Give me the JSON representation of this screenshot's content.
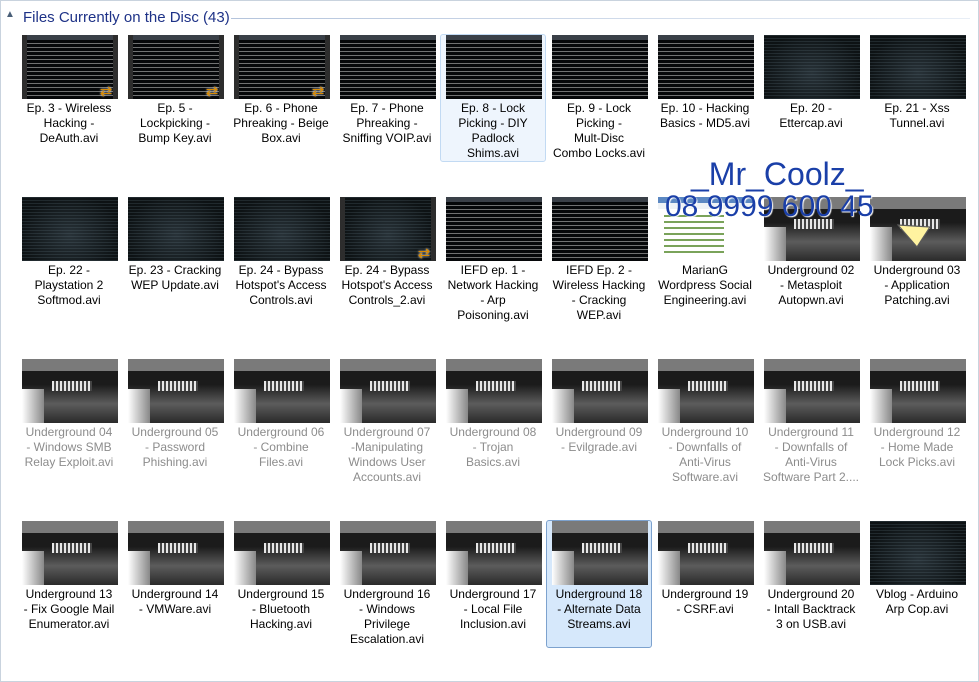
{
  "group": {
    "title": "Files Currently on the Disc (43)",
    "collapse_icon": "chevron-up-icon"
  },
  "watermark": {
    "name": "_Mr_Coolz_",
    "phone": "08 9999 600 45"
  },
  "files": [
    {
      "name": "Ep. 3 - Wireless\nHacking -\nDeAuth.avi",
      "thumb": "term",
      "film": true,
      "badge": true,
      "faded": false,
      "state": ""
    },
    {
      "name": "Ep. 5 -\nLockpicking -\nBump Key.avi",
      "thumb": "term",
      "film": true,
      "badge": true,
      "faded": false,
      "state": ""
    },
    {
      "name": "Ep. 6 - Phone\nPhreaking - Beige\nBox.avi",
      "thumb": "term",
      "film": true,
      "badge": true,
      "faded": false,
      "state": ""
    },
    {
      "name": "Ep. 7 - Phone\nPhreaking -\nSniffing VOIP.avi",
      "thumb": "term",
      "film": false,
      "badge": false,
      "faded": false,
      "state": ""
    },
    {
      "name": "Ep. 8 - Lock\nPicking - DIY\nPadlock\nShims.avi",
      "thumb": "term",
      "film": false,
      "badge": false,
      "faded": false,
      "state": "hover"
    },
    {
      "name": "Ep. 9 - Lock\nPicking -\nMult-Disc\nCombo Locks.avi",
      "thumb": "term",
      "film": false,
      "badge": false,
      "faded": false,
      "state": ""
    },
    {
      "name": "Ep. 10 - Hacking\nBasics - MD5.avi",
      "thumb": "term",
      "film": false,
      "badge": false,
      "faded": false,
      "state": ""
    },
    {
      "name": "Ep. 20 -\nEttercap.avi",
      "thumb": "dark",
      "film": false,
      "badge": false,
      "faded": false,
      "state": ""
    },
    {
      "name": "Ep. 21 - Xss\nTunnel.avi",
      "thumb": "dark",
      "film": false,
      "badge": false,
      "faded": false,
      "state": ""
    },
    {
      "name": "Ep. 22 -\nPlaystation 2\nSoftmod.avi",
      "thumb": "dark",
      "film": false,
      "badge": false,
      "faded": false,
      "state": ""
    },
    {
      "name": "Ep. 23 - Cracking\nWEP Update.avi",
      "thumb": "dark",
      "film": false,
      "badge": false,
      "faded": false,
      "state": ""
    },
    {
      "name": "Ep. 24 - Bypass\nHotspot's Access\nControls.avi",
      "thumb": "dark",
      "film": false,
      "badge": false,
      "faded": false,
      "state": ""
    },
    {
      "name": "Ep. 24 - Bypass\nHotspot's Access\nControls_2.avi",
      "thumb": "dark",
      "film": true,
      "badge": true,
      "faded": false,
      "state": ""
    },
    {
      "name": "IEFD ep. 1 -\nNetwork Hacking\n- Arp\nPoisoning.avi",
      "thumb": "term",
      "film": false,
      "badge": false,
      "faded": false,
      "state": ""
    },
    {
      "name": "IEFD Ep. 2 -\nWireless Hacking\n- Cracking\nWEP.avi",
      "thumb": "term",
      "film": false,
      "badge": false,
      "faded": false,
      "state": ""
    },
    {
      "name": "MarianG\nWordpress Social\nEngineering.avi",
      "thumb": "browser",
      "film": false,
      "badge": false,
      "faded": false,
      "state": ""
    },
    {
      "name": "Underground 02\n- Metasploit\nAutopwn.avi",
      "thumb": "ug",
      "film": false,
      "badge": false,
      "faded": false,
      "state": ""
    },
    {
      "name": "Underground 03\n- Application\nPatching.avi",
      "thumb": "ug",
      "film": false,
      "badge": false,
      "faded": false,
      "state": ""
    },
    {
      "name": "Underground 04\n- Windows SMB\nRelay Exploit.avi",
      "thumb": "ug",
      "film": false,
      "badge": false,
      "faded": true,
      "state": ""
    },
    {
      "name": "Underground 05\n- Password\nPhishing.avi",
      "thumb": "ug",
      "film": false,
      "badge": false,
      "faded": true,
      "state": ""
    },
    {
      "name": "Underground 06\n- Combine\nFiles.avi",
      "thumb": "ug",
      "film": false,
      "badge": false,
      "faded": true,
      "state": ""
    },
    {
      "name": "Underground 07\n-Manipulating\nWindows User\nAccounts.avi",
      "thumb": "ug",
      "film": false,
      "badge": false,
      "faded": true,
      "state": ""
    },
    {
      "name": "Underground 08\n- Trojan\nBasics.avi",
      "thumb": "ug",
      "film": false,
      "badge": false,
      "faded": true,
      "state": ""
    },
    {
      "name": "Underground 09\n- Evilgrade.avi",
      "thumb": "ug",
      "film": false,
      "badge": false,
      "faded": true,
      "state": ""
    },
    {
      "name": "Underground 10\n- Downfalls of\nAnti-Virus\nSoftware.avi",
      "thumb": "ug",
      "film": false,
      "badge": false,
      "faded": true,
      "state": ""
    },
    {
      "name": "Underground 11\n- Downfalls of\nAnti-Virus\nSoftware Part 2....",
      "thumb": "ug",
      "film": false,
      "badge": false,
      "faded": true,
      "state": ""
    },
    {
      "name": "Underground 12\n- Home Made\nLock Picks.avi",
      "thumb": "ug",
      "film": false,
      "badge": false,
      "faded": true,
      "state": ""
    },
    {
      "name": "Underground 13\n- Fix Google Mail\nEnumerator.avi",
      "thumb": "ug",
      "film": false,
      "badge": false,
      "faded": false,
      "state": ""
    },
    {
      "name": "Underground 14\n- VMWare.avi",
      "thumb": "ug",
      "film": false,
      "badge": false,
      "faded": false,
      "state": ""
    },
    {
      "name": "Underground 15\n- Bluetooth\nHacking.avi",
      "thumb": "ug",
      "film": false,
      "badge": false,
      "faded": false,
      "state": ""
    },
    {
      "name": "Underground 16\n- Windows\nPrivilege\nEscalation.avi",
      "thumb": "ug",
      "film": false,
      "badge": false,
      "faded": false,
      "state": ""
    },
    {
      "name": "Underground 17\n- Local File\nInclusion.avi",
      "thumb": "ug",
      "film": false,
      "badge": false,
      "faded": false,
      "state": ""
    },
    {
      "name": "Underground 18\n- Alternate Data\nStreams.avi",
      "thumb": "ug",
      "film": false,
      "badge": false,
      "faded": false,
      "state": "selected"
    },
    {
      "name": "Underground 19\n- CSRF.avi",
      "thumb": "ug",
      "film": false,
      "badge": false,
      "faded": false,
      "state": ""
    },
    {
      "name": "Underground 20\n- Intall Backtrack\n3 on USB.avi",
      "thumb": "ug",
      "film": false,
      "badge": false,
      "faded": false,
      "state": ""
    },
    {
      "name": "Vblog - Arduino\nArp Cop.avi",
      "thumb": "dark",
      "film": false,
      "badge": false,
      "faded": false,
      "state": ""
    }
  ]
}
